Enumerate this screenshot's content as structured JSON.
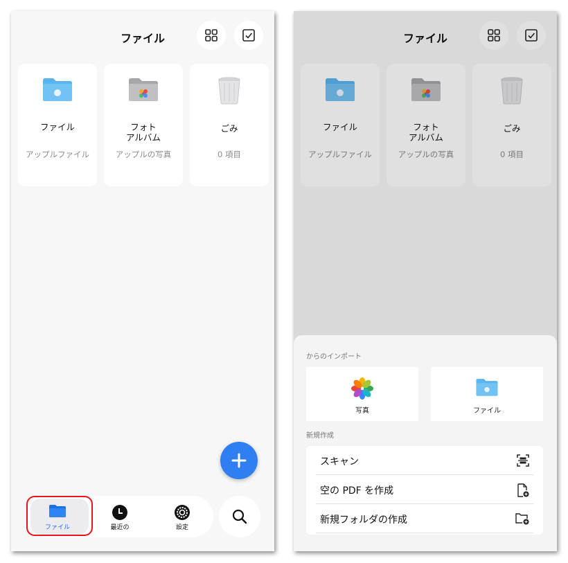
{
  "left_screen": {
    "header": {
      "title": "ファイル",
      "grid_icon": "grid-view-icon",
      "select_icon": "checkbox-select-icon"
    },
    "cards": [
      {
        "name": "ファイル",
        "subtitle": "アップルファイル",
        "icon": "blue-folder-icon"
      },
      {
        "name": "フォト\nアルバム",
        "subtitle": "アップルの写真",
        "icon": "photos-folder-icon"
      },
      {
        "name": "ごみ",
        "subtitle": "0 項目",
        "icon": "trash-icon"
      }
    ],
    "fab_icon": "plus-icon",
    "tabs": [
      {
        "label": "ファイル",
        "icon": "folder-icon",
        "active": true
      },
      {
        "label": "最近の",
        "icon": "clock-icon",
        "active": false
      },
      {
        "label": "設定",
        "icon": "gear-icon",
        "active": false
      }
    ],
    "search_icon": "search-icon",
    "highlight_color": "#e8121a"
  },
  "right_screen": {
    "header": {
      "title": "ファイル"
    },
    "cards": [
      {
        "name": "ファイル",
        "subtitle": "アップルファイル"
      },
      {
        "name": "フォト\nアルバム",
        "subtitle": "アップルの写真"
      },
      {
        "name": "ごみ",
        "subtitle": "0 項目"
      }
    ],
    "sheet": {
      "import_label": "からのインポート",
      "import_options": [
        {
          "label": "写真",
          "icon": "photos-flower-icon"
        },
        {
          "label": "ファイル",
          "icon": "blue-folder-icon"
        }
      ],
      "create_label": "新規作成",
      "create_options": [
        {
          "label": "スキャン",
          "icon": "scan-icon"
        },
        {
          "label": "空の PDF を作成",
          "icon": "new-document-icon"
        },
        {
          "label": "新規フォルダの作成",
          "icon": "new-folder-icon"
        }
      ]
    }
  },
  "colors": {
    "accent": "#2f7ff3",
    "folder_blue": "#5ab4ee",
    "highlight": "#e8121a"
  }
}
